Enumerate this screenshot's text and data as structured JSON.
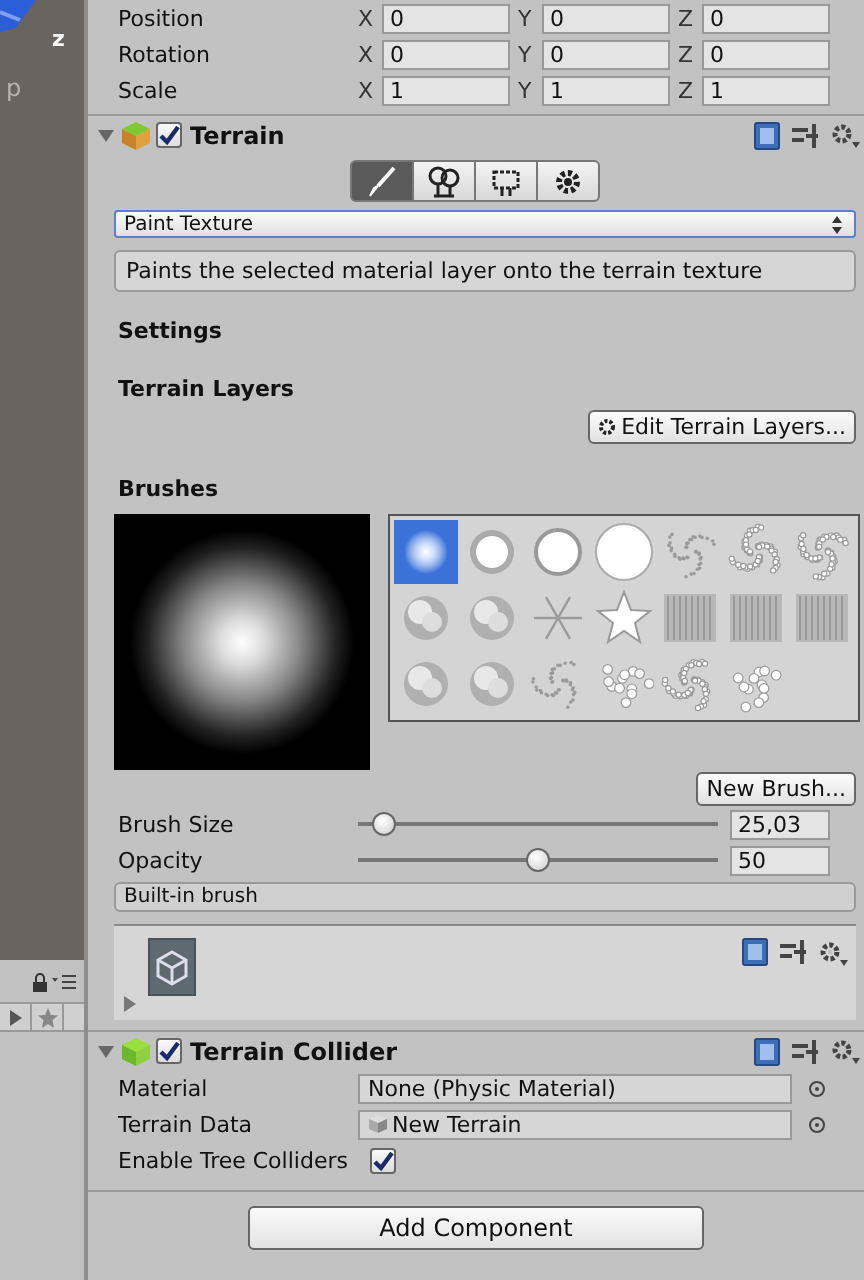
{
  "scene_view": {
    "axis_label": "z",
    "partial_label": "p"
  },
  "transform": [
    {
      "label": "Position",
      "fields": [
        {
          "axis": "X",
          "value": "0"
        },
        {
          "axis": "Y",
          "value": "0"
        },
        {
          "axis": "Z",
          "value": "0"
        }
      ]
    },
    {
      "label": "Rotation",
      "fields": [
        {
          "axis": "X",
          "value": "0"
        },
        {
          "axis": "Y",
          "value": "0"
        },
        {
          "axis": "Z",
          "value": "0"
        }
      ]
    },
    {
      "label": "Scale",
      "fields": [
        {
          "axis": "X",
          "value": "1"
        },
        {
          "axis": "Y",
          "value": "1"
        },
        {
          "axis": "Z",
          "value": "1"
        }
      ]
    }
  ],
  "terrain": {
    "title": "Terrain",
    "expanded": true,
    "enabled": true,
    "tools": [
      {
        "kind": "paint",
        "selected": true
      },
      {
        "kind": "trees",
        "selected": false
      },
      {
        "kind": "details",
        "selected": false
      },
      {
        "kind": "settings",
        "selected": false
      }
    ],
    "mode_dropdown": "Paint Texture",
    "help_text": "Paints the selected material layer onto the terrain texture",
    "settings_heading": "Settings",
    "layers_heading": "Terrain Layers",
    "edit_layers_button": "Edit Terrain Layers...",
    "brushes_heading": "Brushes",
    "brushes": [
      {
        "kind": "soft",
        "selected": true
      },
      {
        "kind": "halo",
        "selected": false
      },
      {
        "kind": "ring",
        "selected": false
      },
      {
        "kind": "disc",
        "selected": false
      },
      {
        "kind": "speckle",
        "selected": false
      },
      {
        "kind": "splatter",
        "selected": false
      },
      {
        "kind": "splatter",
        "selected": false
      },
      {
        "kind": "cloud",
        "selected": false
      },
      {
        "kind": "cloud",
        "selected": false
      },
      {
        "kind": "spark",
        "selected": false
      },
      {
        "kind": "star",
        "selected": false
      },
      {
        "kind": "streak",
        "selected": false
      },
      {
        "kind": "streak",
        "selected": false
      },
      {
        "kind": "streak",
        "selected": false
      },
      {
        "kind": "cloud",
        "selected": false
      },
      {
        "kind": "cloud",
        "selected": false
      },
      {
        "kind": "speckle",
        "selected": false
      },
      {
        "kind": "dots",
        "selected": false
      },
      {
        "kind": "splatter",
        "selected": false
      },
      {
        "kind": "dots",
        "selected": false
      }
    ],
    "new_brush_button": "New Brush...",
    "sliders": [
      {
        "label": "Brush Size",
        "level": 0.04,
        "value": "25,03"
      },
      {
        "label": "Opacity",
        "level": 0.5,
        "value": "50"
      }
    ],
    "brush_source": "Built-in brush"
  },
  "asset_preview": {
    "expanded": false
  },
  "terrain_collider": {
    "title": "Terrain Collider",
    "expanded": true,
    "enabled": true,
    "fields": [
      {
        "label": "Material",
        "value": "None (Physic Material)",
        "kind": "object"
      },
      {
        "label": "Terrain Data",
        "value": "New Terrain",
        "kind": "asset"
      }
    ],
    "tree_colliders": {
      "label": "Enable Tree Colliders",
      "checked": true
    }
  },
  "add_component_button": "Add Component"
}
